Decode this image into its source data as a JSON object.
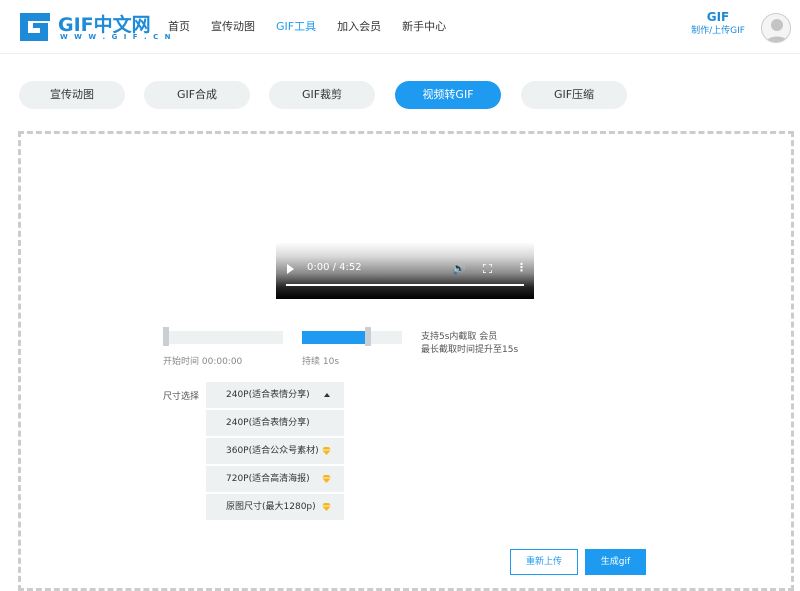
{
  "brand": {
    "name": "GIF中文网",
    "url_text": "W W W . G I F . C N",
    "color": "#1e8bd8"
  },
  "nav": {
    "items": [
      {
        "label": "首页",
        "active": false
      },
      {
        "label": "宣传动图",
        "active": false
      },
      {
        "label": "GIF工具",
        "active": true
      },
      {
        "label": "加入会员",
        "active": false
      },
      {
        "label": "新手中心",
        "active": false
      }
    ]
  },
  "header_right": {
    "title": "GIF",
    "subtitle": "制作/上传GIF"
  },
  "tabs": [
    {
      "label": "宣传动图",
      "active": false
    },
    {
      "label": "GIF合成",
      "active": false
    },
    {
      "label": "GIF裁剪",
      "active": false
    },
    {
      "label": "视频转GIF",
      "active": true
    },
    {
      "label": "GIF压缩",
      "active": false
    }
  ],
  "video": {
    "time": "0:00 / 4:52",
    "progress": 0
  },
  "trim": {
    "start_label": "开始时间  00:00:00",
    "duration_label": "持续  10s",
    "duration_fill": 0.66,
    "hint_line1": "支持5s内截取 会员",
    "hint_line2": "最长截取时间提升至15s"
  },
  "size": {
    "label": "尺寸选择",
    "selected": "240P(适合表情分享)",
    "options": [
      {
        "label": "240P(适合表情分享)",
        "premium": false
      },
      {
        "label": "360P(适合公众号素材)",
        "premium": true
      },
      {
        "label": "720P(适合高清海报)",
        "premium": true
      },
      {
        "label": "原图尺寸(最大1280p)",
        "premium": true
      }
    ]
  },
  "buttons": {
    "reupload": "重新上传",
    "generate": "生成gif"
  },
  "colors": {
    "accent": "#1e9bf0",
    "premium": "#f5b720",
    "tab_bg": "#eef1f2"
  }
}
